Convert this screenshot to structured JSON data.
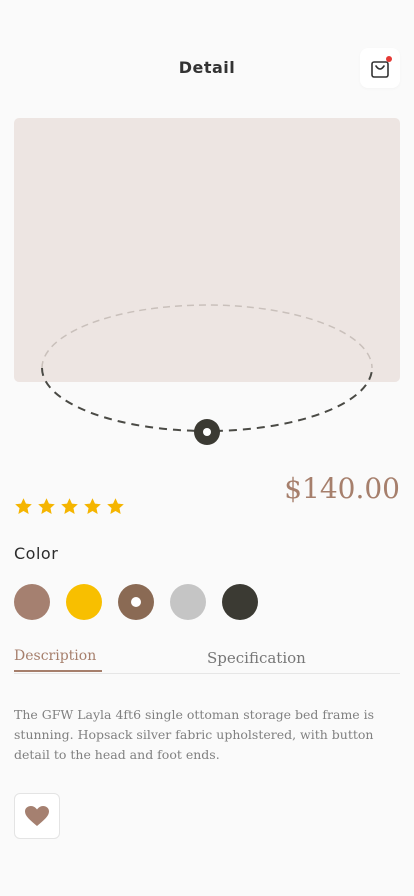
{
  "header": {
    "title": "Detail",
    "cart_icon": "shopping-bag-icon",
    "cart_badge_color": "#e53935"
  },
  "product": {
    "price": "$140.00",
    "rating": 5,
    "rating_max": 5,
    "star_color": "#f5b500",
    "image_background": "#ede5e2",
    "description": "The GFW Layla 4ft6 single ottoman storage bed frame is stunning. Hopsack silver fabric upholstered, with button detail to the head and foot ends."
  },
  "color_section": {
    "label": "Color",
    "swatches": [
      {
        "color": "#a58070",
        "selected": false
      },
      {
        "color": "#f8bf00",
        "selected": false
      },
      {
        "color": "#8a6a54",
        "selected": true
      },
      {
        "color": "#c5c5c5",
        "selected": false
      },
      {
        "color": "#3b3a33",
        "selected": false
      }
    ]
  },
  "tabs": [
    {
      "label": "Description",
      "active": true
    },
    {
      "label": "Specification",
      "active": false
    }
  ],
  "actions": {
    "favorite_icon": "heart-icon",
    "favorite_color": "#a58070"
  },
  "colors": {
    "accent": "#a67f6c",
    "dark": "#3b3a33"
  }
}
